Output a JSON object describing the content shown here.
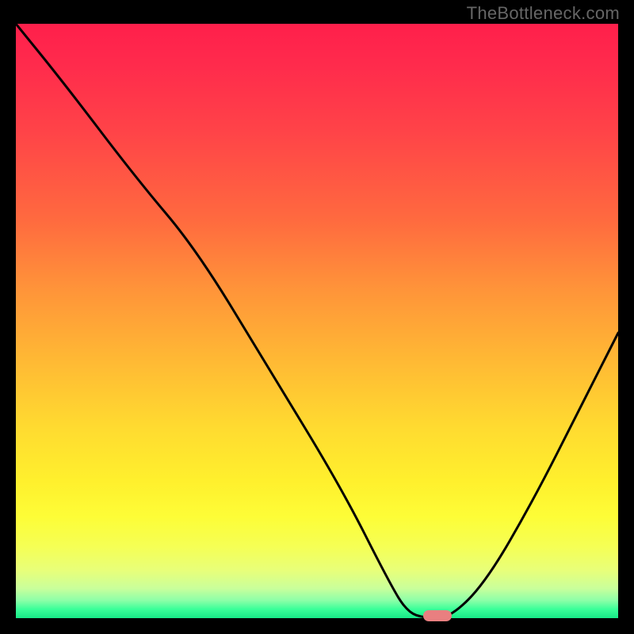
{
  "watermark": "TheBottleneck.com",
  "colors": {
    "frame_bg": "#000000",
    "curve": "#000000",
    "marker": "#e97f80",
    "watermark_text": "#666666"
  },
  "chart_data": {
    "type": "line",
    "title": "",
    "xlabel": "",
    "ylabel": "",
    "xlim": [
      0,
      100
    ],
    "ylim": [
      0,
      100
    ],
    "grid": false,
    "legend": false,
    "gradient_stops": [
      {
        "pos": 0,
        "color": "#ff1f4b"
      },
      {
        "pos": 7,
        "color": "#ff2b4c"
      },
      {
        "pos": 18,
        "color": "#ff4348"
      },
      {
        "pos": 33,
        "color": "#ff6a3f"
      },
      {
        "pos": 45,
        "color": "#ff9539"
      },
      {
        "pos": 57,
        "color": "#ffba34"
      },
      {
        "pos": 68,
        "color": "#ffdb30"
      },
      {
        "pos": 77,
        "color": "#fff02d"
      },
      {
        "pos": 83,
        "color": "#fdfd37"
      },
      {
        "pos": 88,
        "color": "#f5ff55"
      },
      {
        "pos": 92,
        "color": "#e8ff7a"
      },
      {
        "pos": 95,
        "color": "#c9ff9b"
      },
      {
        "pos": 97,
        "color": "#8dffa8"
      },
      {
        "pos": 98.5,
        "color": "#3aff99"
      },
      {
        "pos": 100,
        "color": "#17e987"
      }
    ],
    "series": [
      {
        "name": "bottleneck-curve",
        "x": [
          0,
          8,
          20,
          30,
          42,
          54,
          62,
          65,
          68,
          72,
          78,
          86,
          94,
          100
        ],
        "y": [
          100,
          90,
          74,
          62,
          42,
          22,
          6,
          1,
          0,
          0,
          6,
          20,
          36,
          48
        ]
      }
    ],
    "optimum_marker": {
      "x": 70,
      "y": 0
    }
  }
}
